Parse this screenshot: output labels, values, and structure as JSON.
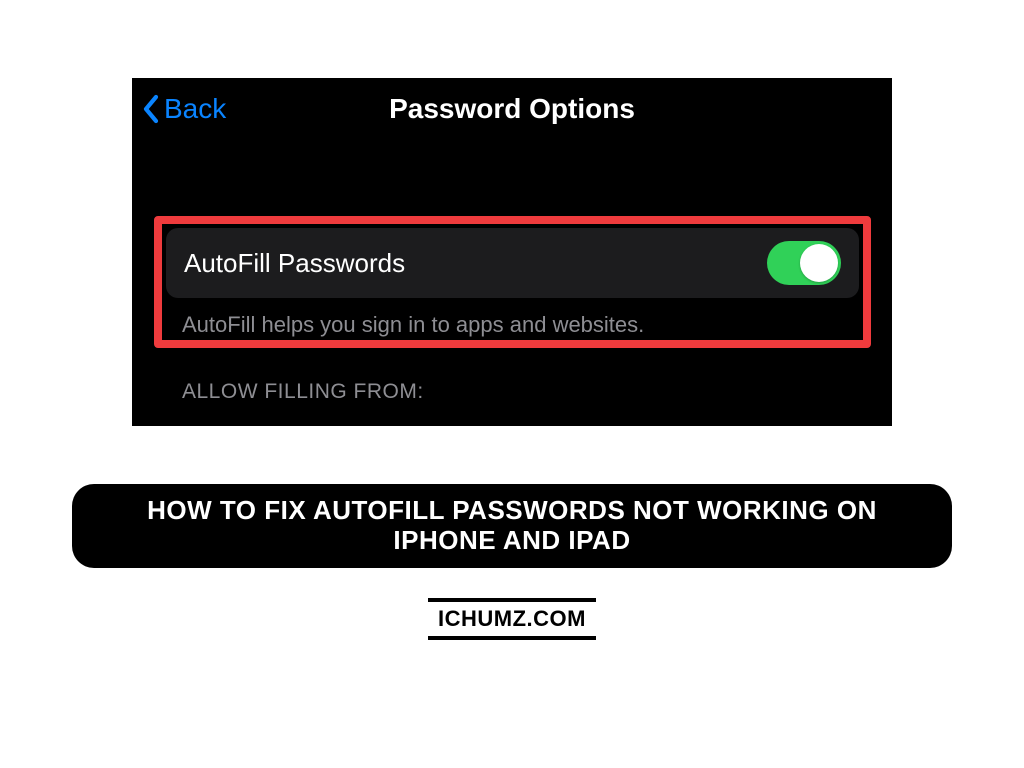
{
  "nav": {
    "back_label": "Back",
    "title": "Password Options"
  },
  "setting": {
    "autofill_label": "AutoFill Passwords",
    "autofill_footer": "AutoFill helps you sign in to apps and websites.",
    "toggle_on": true
  },
  "section": {
    "allow_filling_header": "ALLOW FILLING FROM:"
  },
  "banner": {
    "title": "HOW TO FIX AUTOFILL PASSWORDS NOT WORKING ON IPHONE AND IPAD",
    "website": "ICHUMZ.COM"
  },
  "colors": {
    "ios_blue": "#0a84ff",
    "ios_green": "#30d158",
    "highlight_red": "#ef3b3d",
    "cell_bg": "#1c1c1e",
    "secondary_text": "#8e8e93"
  }
}
